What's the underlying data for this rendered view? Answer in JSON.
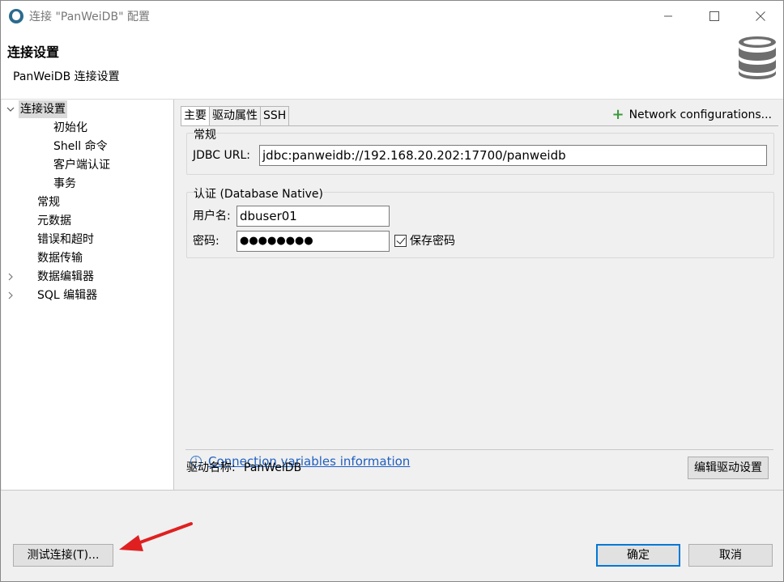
{
  "window": {
    "title": "连接 \"PanWeiDB\" 配置"
  },
  "header": {
    "title": "连接设置",
    "subtitle": "PanWeiDB 连接设置",
    "icon": "database-icon"
  },
  "tree": {
    "items": [
      {
        "label": "连接设置",
        "expanded": true,
        "selected": true
      },
      {
        "label": "初始化"
      },
      {
        "label": "Shell 命令"
      },
      {
        "label": "客户端认证"
      },
      {
        "label": "事务"
      },
      {
        "label": "常规"
      },
      {
        "label": "元数据"
      },
      {
        "label": "错误和超时"
      },
      {
        "label": "数据传输"
      },
      {
        "label": "数据编辑器",
        "expandable": true
      },
      {
        "label": "SQL 编辑器",
        "expandable": true
      }
    ]
  },
  "tabs": [
    {
      "label": "主要",
      "active": true
    },
    {
      "label": "驱动属性"
    },
    {
      "label": "SSH"
    }
  ],
  "network_config_label": "Network configurations...",
  "general": {
    "title": "常规",
    "jdbc_label": "JDBC URL:",
    "jdbc_value": "jdbc:panweidb://192.168.20.202:17700/panweidb"
  },
  "auth": {
    "title": "认证 (Database Native)",
    "username_label": "用户名:",
    "username_value": "dbuser01",
    "password_label": "密码:",
    "password_value": "●●●●●●●●",
    "save_password_label": "保存密码",
    "save_password_checked": true
  },
  "info_link": "Connection variables information",
  "driver": {
    "label": "驱动名称:",
    "value": "PanWeiDB",
    "edit_button": "编辑驱动设置"
  },
  "footer": {
    "test_button": "测试连接(T)...",
    "ok_button": "确定",
    "cancel_button": "取消"
  },
  "colors": {
    "accent": "#0078d7",
    "link": "#1f5fbf",
    "plus": "#3c9a3c",
    "arrow": "#e02020"
  }
}
